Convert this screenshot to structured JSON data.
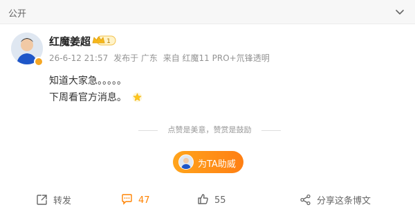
{
  "topbar": {
    "visibility": "公开"
  },
  "post": {
    "username": "红魔姜超",
    "vip_level": "1",
    "meta": {
      "time": "26-6-12 21:57",
      "location": "发布于 广东",
      "source": "来自 红魔11 PRO+氘锋透明"
    },
    "content_lines": [
      "知道大家急。。。。。",
      "下周看官方消息。"
    ],
    "divider_text": "点赞是美意，赞赏是鼓励",
    "support_button": "为TA助威"
  },
  "actions": {
    "repost_label": "转发",
    "comment_count": "47",
    "like_count": "55",
    "share_label": "分享这条博文"
  },
  "colors": {
    "accent": "#ff8200",
    "button_gradient_start": "#ffa41c",
    "button_gradient_end": "#ff7f13"
  }
}
